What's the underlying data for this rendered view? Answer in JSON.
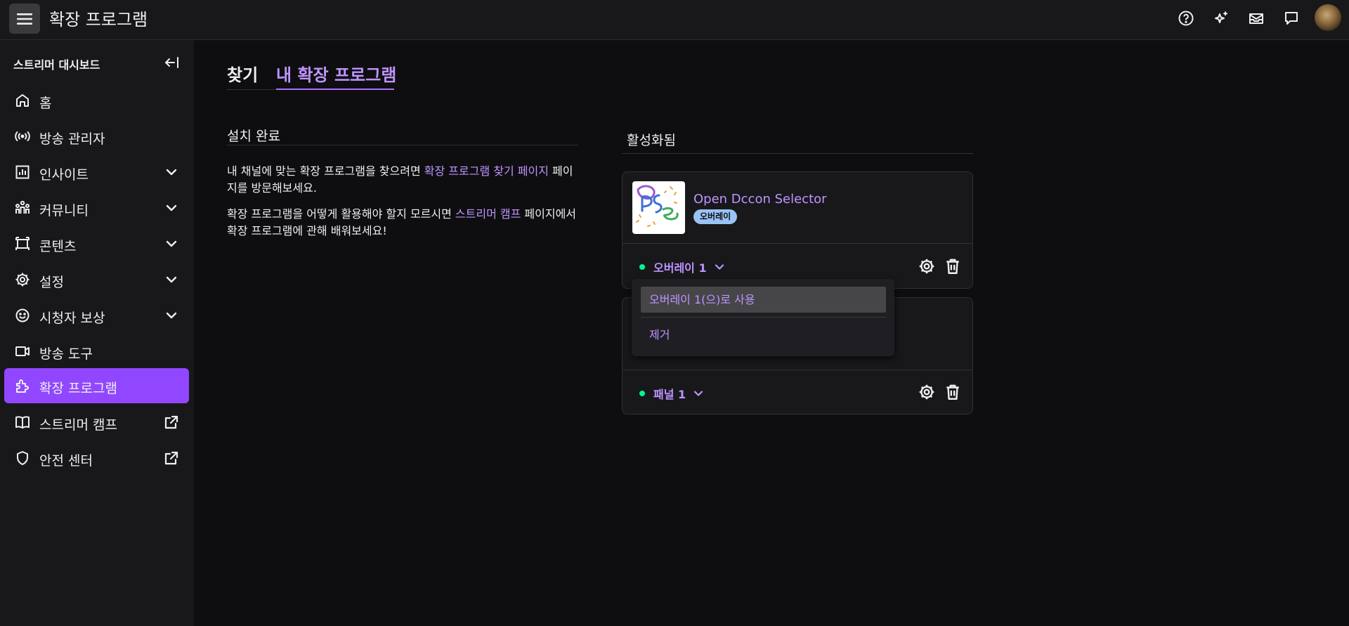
{
  "header": {
    "title": "확장 프로그램",
    "icons": [
      "menu-icon",
      "help-icon",
      "sparkle-icon",
      "inbox-icon",
      "whispers-icon",
      "avatar"
    ]
  },
  "sidebar": {
    "header": "스트리머 대시보드",
    "items": [
      {
        "label": "홈",
        "icon": "home-icon",
        "chevron": false,
        "external": false,
        "active": false
      },
      {
        "label": "방송 관리자",
        "icon": "broadcast-icon",
        "chevron": false,
        "external": false,
        "active": false
      },
      {
        "label": "인사이트",
        "icon": "insights-icon",
        "chevron": true,
        "external": false,
        "active": false
      },
      {
        "label": "커뮤니티",
        "icon": "community-icon",
        "chevron": true,
        "external": false,
        "active": false
      },
      {
        "label": "콘텐츠",
        "icon": "content-icon",
        "chevron": true,
        "external": false,
        "active": false
      },
      {
        "label": "설정",
        "icon": "settings-icon",
        "chevron": true,
        "external": false,
        "active": false
      },
      {
        "label": "시청자 보상",
        "icon": "rewards-icon",
        "chevron": true,
        "external": false,
        "active": false
      },
      {
        "label": "방송 도구",
        "icon": "camera-icon",
        "chevron": false,
        "external": false,
        "active": false
      },
      {
        "label": "확장 프로그램",
        "icon": "extensions-icon",
        "chevron": false,
        "external": false,
        "active": true
      },
      {
        "label": "스트리머 캠프",
        "icon": "book-icon",
        "chevron": false,
        "external": true,
        "active": false
      },
      {
        "label": "안전 센터",
        "icon": "shield-icon",
        "chevron": false,
        "external": true,
        "active": false
      }
    ]
  },
  "tabs": [
    {
      "label": "찾기",
      "active": false
    },
    {
      "label": "내 확장 프로그램",
      "active": true
    }
  ],
  "installed": {
    "title": "설치 완료",
    "para1_pre": "내 채널에 맞는 확장 프로그램을 찾으려면 ",
    "para1_link": "확장 프로그램 찾기 페이지",
    "para1_post": " 페이지를 방문해보세요.",
    "para2_pre": "확장 프로그램을 어떻게 활용해야 할지 모르시면 ",
    "para2_link": "스트리머 캠프",
    "para2_post": " 페이지에서 확장 프로그램에 관해 배워보세요!"
  },
  "activated": {
    "title": "활성화됨",
    "cards": [
      {
        "name": "Open Dccon Selector",
        "badge": "오버레이",
        "slot": "오버레이 1"
      },
      {
        "slot": "패널 1"
      }
    ]
  },
  "dropdown": {
    "items": [
      "오버레이 1(으)로 사용",
      "제거"
    ]
  },
  "colors": {
    "accent": "#9147ff",
    "link": "#bf94ff",
    "status_dot": "#00f593",
    "badge": "#9ac3f5"
  }
}
